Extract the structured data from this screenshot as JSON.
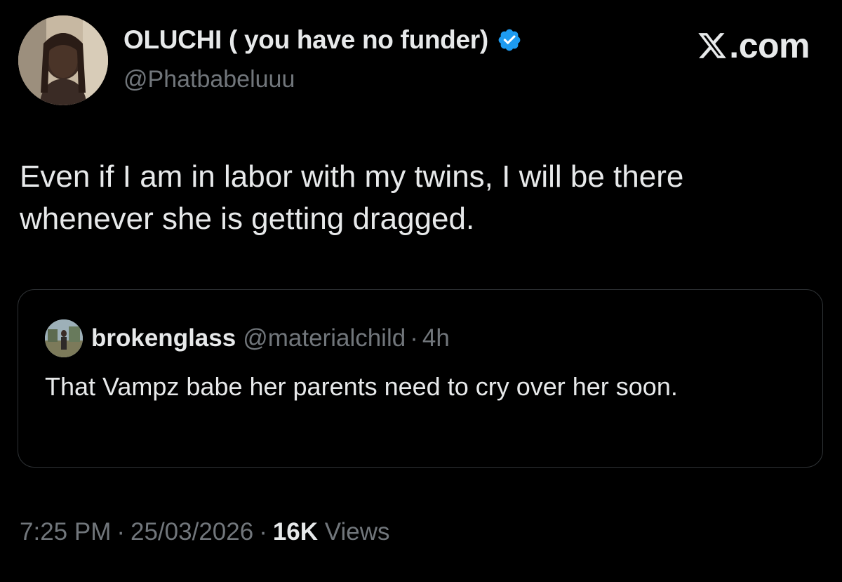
{
  "author": {
    "name": "OLUCHI ( you have no funder)",
    "handle": "@Phatbabeluuu",
    "verified_icon": "verified-badge-icon",
    "verified_color": "#1d9bf0"
  },
  "brand": {
    "icon": "x-logo-icon",
    "domain": ".com"
  },
  "tweet": {
    "text": "Even if I am in labor with my twins, I will be there whenever she is getting dragged."
  },
  "quote": {
    "name": "brokenglass",
    "handle": "@materialchild",
    "separator": "·",
    "time": "4h",
    "text": "That Vampz babe her parents need to cry over her soon."
  },
  "meta": {
    "time": "7:25 PM",
    "separator": "·",
    "date": "25/03/2026",
    "views_count": "16K",
    "views_label": "Views"
  },
  "colors": {
    "background": "#000000",
    "primary_text": "#e7e9ea",
    "secondary_text": "#71767b",
    "border": "#2f3336",
    "accent": "#1d9bf0"
  }
}
